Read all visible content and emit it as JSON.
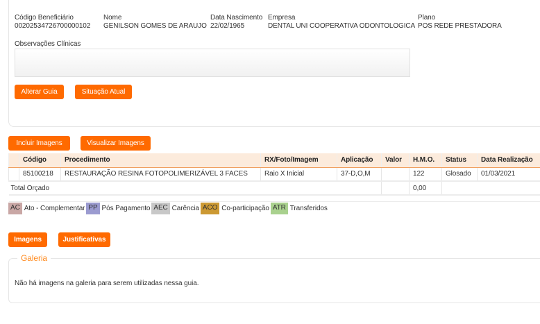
{
  "beneficiary": {
    "fields": [
      {
        "label": "Código Beneficiário",
        "value": "00202534726700000102"
      },
      {
        "label": "Nome",
        "value": "GENILSON GOMES DE ARAUJO"
      },
      {
        "label": "Data Nascimento",
        "value": "22/02/1965"
      },
      {
        "label": "Empresa",
        "value": "DENTAL UNI COOPERATIVA ODONTOLOGICA"
      },
      {
        "label": "Plano",
        "value": "POS REDE PRESTADORA"
      }
    ],
    "observations_label": "Observações Clínicas",
    "observations_value": "",
    "alter_button": "Alterar Guia",
    "status_button": "Situação Atual"
  },
  "images": {
    "include_button": "Incluir Imagens",
    "view_button": "Visualizar Imagens"
  },
  "table": {
    "headers": [
      "Código",
      "Procedimento",
      "RX/Foto/Imagem",
      "Aplicação",
      "Valor",
      "H.M.O.",
      "Status",
      "Data Realização"
    ],
    "rows": [
      [
        "85100218",
        "RESTAURAÇÃO RESINA FOTOPOLIMERIZÁVEL 3 FACES",
        "Raio X Inicial",
        "37-D,O,M",
        "",
        "122",
        "Glosado",
        "01/03/2021"
      ]
    ],
    "total_label": "Total Orçado",
    "total_hmo": "0,00"
  },
  "legend": [
    {
      "code": "AC",
      "label": "Ato - Complementar",
      "color": "#c9a7a5"
    },
    {
      "code": "PP",
      "label": "Pós Pagamento",
      "color": "#9b9bd0"
    },
    {
      "code": "AEC",
      "label": "Carência",
      "color": "#c8c8c8"
    },
    {
      "code": "ACO",
      "label": "Co-participação",
      "color": "#cc9933"
    },
    {
      "code": "ATR",
      "label": "Transferidos",
      "color": "#a9d18e"
    }
  ],
  "bottom": {
    "images_button": "Imagens",
    "justifications_button": "Justificativas"
  },
  "gallery": {
    "title": "Galeria",
    "empty_message": "Não há imagens na galeria para serem utilizadas nessa guia."
  }
}
